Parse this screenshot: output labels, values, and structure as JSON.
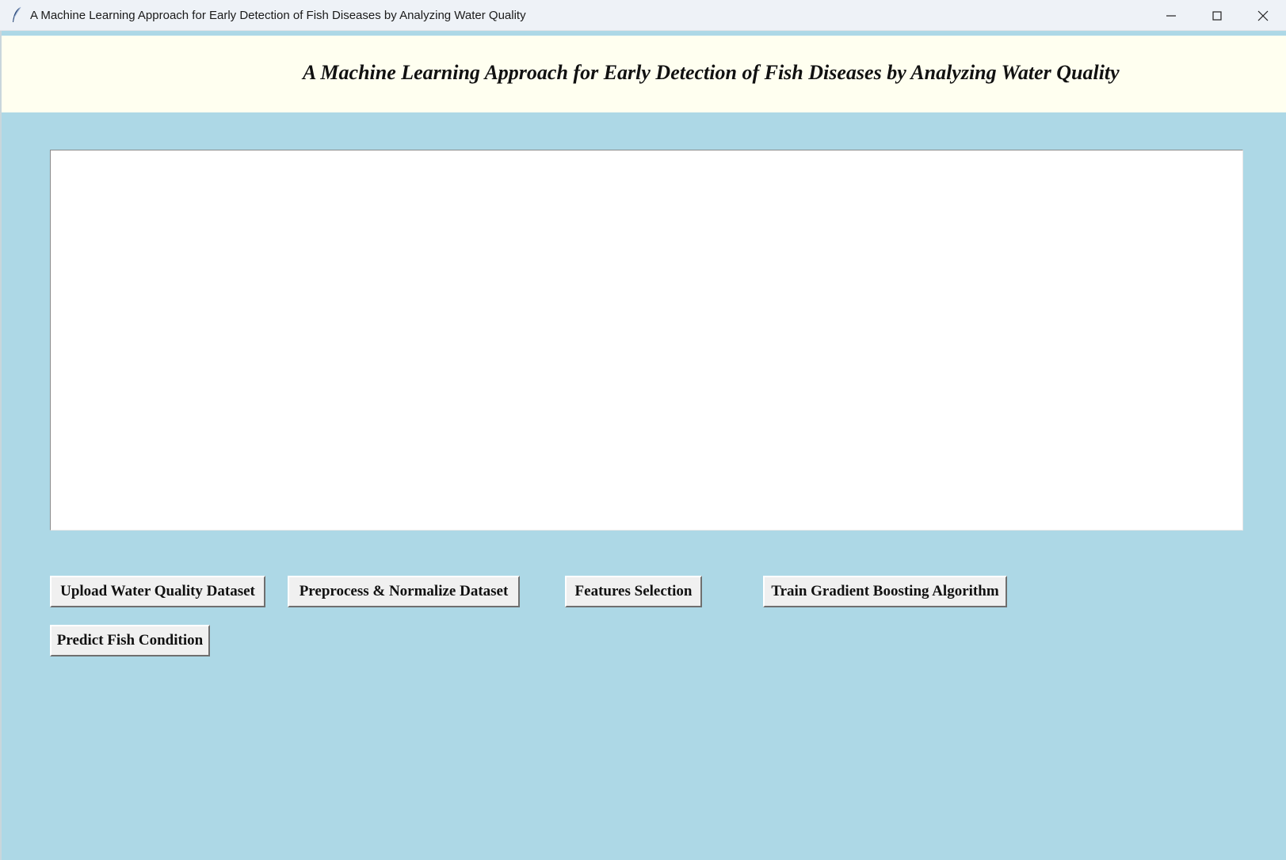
{
  "window": {
    "title": "A Machine Learning Approach for Early Detection of Fish Diseases by Analyzing Water Quality",
    "controls": {
      "minimize_icon": "minimize-icon",
      "maximize_icon": "maximize-icon",
      "close_icon": "close-icon"
    }
  },
  "header": {
    "title": "A Machine Learning Approach for Early Detection of Fish Diseases by Analyzing Water Quality"
  },
  "output": {
    "text": ""
  },
  "buttons": {
    "upload": "Upload Water Quality Dataset",
    "preprocess": "Preprocess & Normalize Dataset",
    "features": "Features Selection",
    "train": "Train Gradient Boosting Algorithm",
    "predict": "Predict Fish Condition"
  },
  "colors": {
    "background": "#add8e6",
    "header_background": "#fffff0",
    "button_face": "#f0f0f0",
    "titlebar": "#eef2f7"
  }
}
